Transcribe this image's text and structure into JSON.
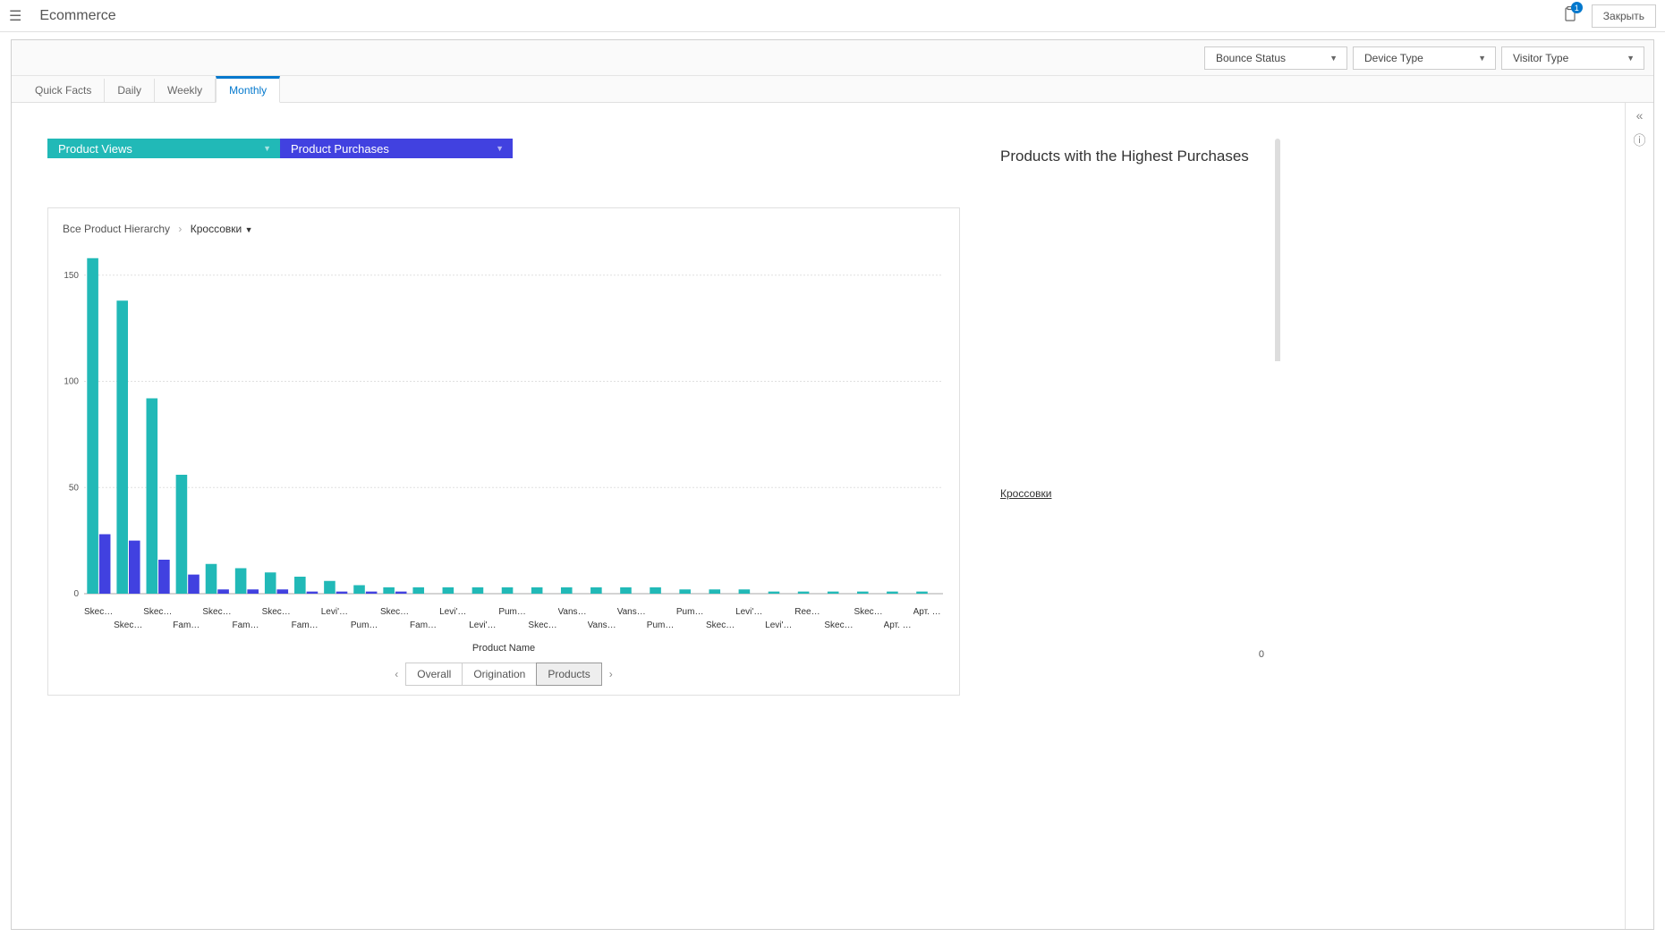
{
  "header": {
    "title": "Ecommerce",
    "clipboard_badge": "1",
    "close_label": "Закрыть"
  },
  "filters": {
    "bounce": "Bounce Status",
    "device": "Device Type",
    "visitor": "Visitor Type"
  },
  "tabs": {
    "quick": "Quick Facts",
    "daily": "Daily",
    "weekly": "Weekly",
    "monthly": "Monthly"
  },
  "legend": {
    "views": "Product Views",
    "purchases": "Product Purchases"
  },
  "breadcrumb": {
    "root": "Все Product Hierarchy",
    "current": "Кроссовки"
  },
  "axis": {
    "x_title": "Product Name"
  },
  "subtabs": {
    "overall": "Overall",
    "origination": "Origination",
    "products": "Products"
  },
  "side": {
    "title": "Products with the Highest Purchases",
    "link": "Кроссовки",
    "zero": "0"
  },
  "chart_data": {
    "type": "bar",
    "ylim": [
      0,
      160
    ],
    "yticks": [
      0,
      50,
      100,
      150
    ],
    "xlabel": "Product Name",
    "series": [
      {
        "name": "Product Views",
        "color": "#21b9b7"
      },
      {
        "name": "Product Purchases",
        "color": "#4141e0"
      }
    ],
    "categories_top": [
      "Skeche...",
      "",
      "Skechers...",
      "",
      "Skechers...",
      "",
      "Skechers...",
      "",
      "Levi's SS...",
      "",
      "Skechers...",
      "",
      "Levi's SSLMB",
      "",
      "Puma SSP...",
      "",
      "Vans SSV...",
      "",
      "Vans SSV...",
      "",
      "Puma SSP...",
      "",
      "Levi's SS...",
      "",
      "Reebok S...",
      "",
      "Skechers...",
      "",
      "Арт. LE..."
    ],
    "categories_bottom": [
      "",
      "Skechers...",
      "",
      "Famous Br...",
      "",
      "Famous Br...",
      "",
      "Famous Br...",
      "",
      "Puma SS...",
      "",
      "Famous B...",
      "",
      "Levi's SS...",
      "",
      "Skechers...",
      "",
      "Vans SSVUW",
      "",
      "Puma SSP...",
      "",
      "Skechers...",
      "",
      "Levi's SSLUG",
      "",
      "Skechers...",
      "",
      "Арт. F 560..."
    ],
    "data": [
      {
        "views": 158,
        "purchases": 28
      },
      {
        "views": 138,
        "purchases": 25
      },
      {
        "views": 92,
        "purchases": 16
      },
      {
        "views": 56,
        "purchases": 9
      },
      {
        "views": 14,
        "purchases": 2
      },
      {
        "views": 12,
        "purchases": 2
      },
      {
        "views": 10,
        "purchases": 2
      },
      {
        "views": 8,
        "purchases": 1
      },
      {
        "views": 6,
        "purchases": 1
      },
      {
        "views": 4,
        "purchases": 1
      },
      {
        "views": 3,
        "purchases": 1
      },
      {
        "views": 3,
        "purchases": 0
      },
      {
        "views": 3,
        "purchases": 0
      },
      {
        "views": 3,
        "purchases": 0
      },
      {
        "views": 3,
        "purchases": 0
      },
      {
        "views": 3,
        "purchases": 0
      },
      {
        "views": 3,
        "purchases": 0
      },
      {
        "views": 3,
        "purchases": 0
      },
      {
        "views": 3,
        "purchases": 0
      },
      {
        "views": 3,
        "purchases": 0
      },
      {
        "views": 2,
        "purchases": 0
      },
      {
        "views": 2,
        "purchases": 0
      },
      {
        "views": 2,
        "purchases": 0
      },
      {
        "views": 1,
        "purchases": 0
      },
      {
        "views": 1,
        "purchases": 0
      },
      {
        "views": 1,
        "purchases": 0
      },
      {
        "views": 1,
        "purchases": 0
      },
      {
        "views": 1,
        "purchases": 0
      },
      {
        "views": 1,
        "purchases": 0
      }
    ]
  }
}
